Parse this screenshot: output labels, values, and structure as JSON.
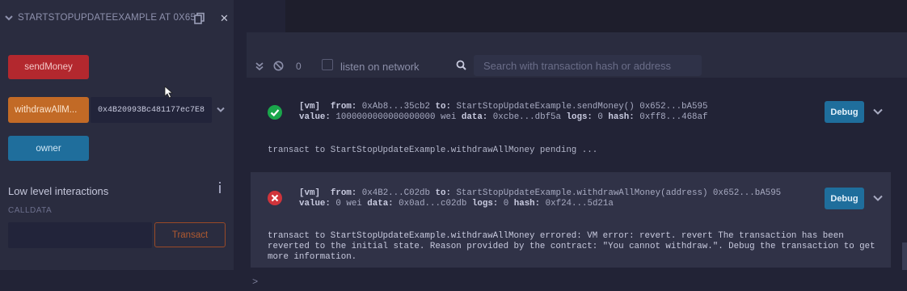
{
  "contract": {
    "title": "STARTSTOPUPDATEEXAMPLE AT 0X65",
    "buttons": {
      "send": "sendMoney",
      "withdraw": "withdrawAllM...",
      "owner": "owner"
    },
    "withdraw_address": "0x4B20993Bc481177ec7E8",
    "low_level_title": "Low level interactions",
    "calldata_label": "CALLDATA",
    "calldata_value": "",
    "transact_label": "Transact"
  },
  "terminal": {
    "count": "0",
    "listen_label": "listen on network",
    "search_placeholder": "Search with transaction hash or address",
    "prompt": ">"
  },
  "transactions": [
    {
      "status": "success",
      "vm": "[vm]",
      "from_label": "from:",
      "from": "0xAb8...35cb2",
      "to_label": "to:",
      "to": "StartStopUpdateExample.sendMoney() 0x652...bA595",
      "value_label": "value:",
      "value": "1000000000000000000 wei",
      "data_label": "data:",
      "data": "0xcbe...dbf5a",
      "logs_label": "logs:",
      "logs": "0",
      "hash_label": "hash:",
      "hash": "0xff8...468af",
      "debug_label": "Debug"
    },
    {
      "status": "error",
      "vm": "[vm]",
      "from_label": "from:",
      "from": "0x4B2...C02db",
      "to_label": "to:",
      "to": "StartStopUpdateExample.withdrawAllMoney(address) 0x652...bA595",
      "value_label": "value:",
      "value": "0 wei",
      "data_label": "data:",
      "data": "0x0ad...c02db",
      "logs_label": "logs:",
      "logs": "0",
      "hash_label": "hash:",
      "hash": "0xf24...5d21a",
      "debug_label": "Debug"
    }
  ],
  "pending_message": "transact to StartStopUpdateExample.withdrawAllMoney pending ...",
  "error_message": "transact to StartStopUpdateExample.withdrawAllMoney errored: VM error: revert. revert The transaction has been reverted to the initial state. Reason provided by the contract: \"You cannot withdraw.\". Debug the transaction to get more information.",
  "colors": {
    "success": "#1aa64b",
    "error": "#d0343b",
    "accent": "#1f6e9c"
  }
}
